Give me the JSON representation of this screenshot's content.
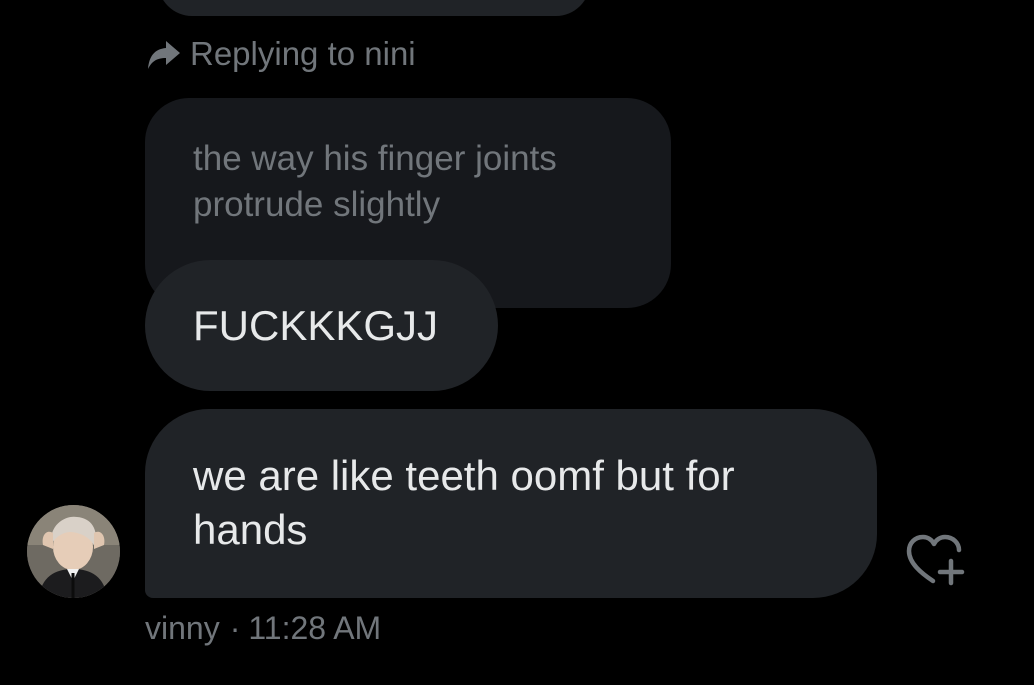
{
  "conversation": {
    "reply_context": {
      "label": "Replying to nini"
    },
    "quoted_message": {
      "text": "the way his finger joints\nprotrude slightly"
    },
    "messages": [
      {
        "text": "FUCKKKGJJ"
      },
      {
        "text": "we are like teeth oomf but for hands"
      }
    ],
    "sender": {
      "name": "vinny",
      "separator": "·",
      "time": "11:28 AM"
    }
  },
  "icons": {
    "reply": "reply-arrow-icon",
    "react": "heart-plus-icon"
  },
  "colors": {
    "background": "#000000",
    "bubble": "#202327",
    "quoted_bubble": "#16181c",
    "muted_text": "#71767b",
    "text": "#e7e9ea"
  }
}
